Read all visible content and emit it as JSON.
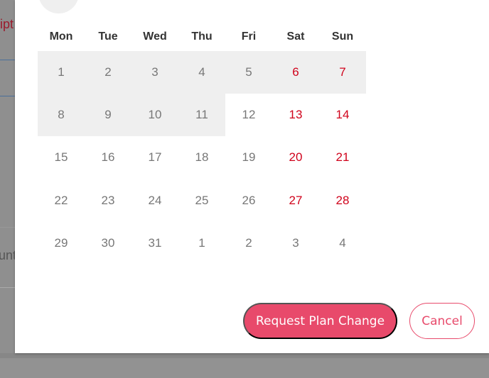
{
  "background": {
    "fragment_top": "ipt",
    "fragment_bottom": "unt"
  },
  "calendar": {
    "weekdays": [
      "Mon",
      "Tue",
      "Wed",
      "Thu",
      "Fri",
      "Sat",
      "Sun"
    ],
    "weeks": [
      [
        "1",
        "2",
        "3",
        "4",
        "5",
        "6",
        "7"
      ],
      [
        "8",
        "9",
        "10",
        "11",
        "12",
        "13",
        "14"
      ],
      [
        "15",
        "16",
        "17",
        "18",
        "19",
        "20",
        "21"
      ],
      [
        "22",
        "23",
        "24",
        "25",
        "26",
        "27",
        "28"
      ],
      [
        "29",
        "30",
        "31",
        "1",
        "2",
        "3",
        "4"
      ]
    ],
    "highlighted_days": [
      "1",
      "2",
      "3",
      "4",
      "5",
      "6",
      "7",
      "8",
      "9",
      "10",
      "11"
    ],
    "weekend_color": "#d0021b"
  },
  "actions": {
    "request_label": "Request Plan Change",
    "cancel_label": "Cancel",
    "accent": "#e84a6b"
  }
}
